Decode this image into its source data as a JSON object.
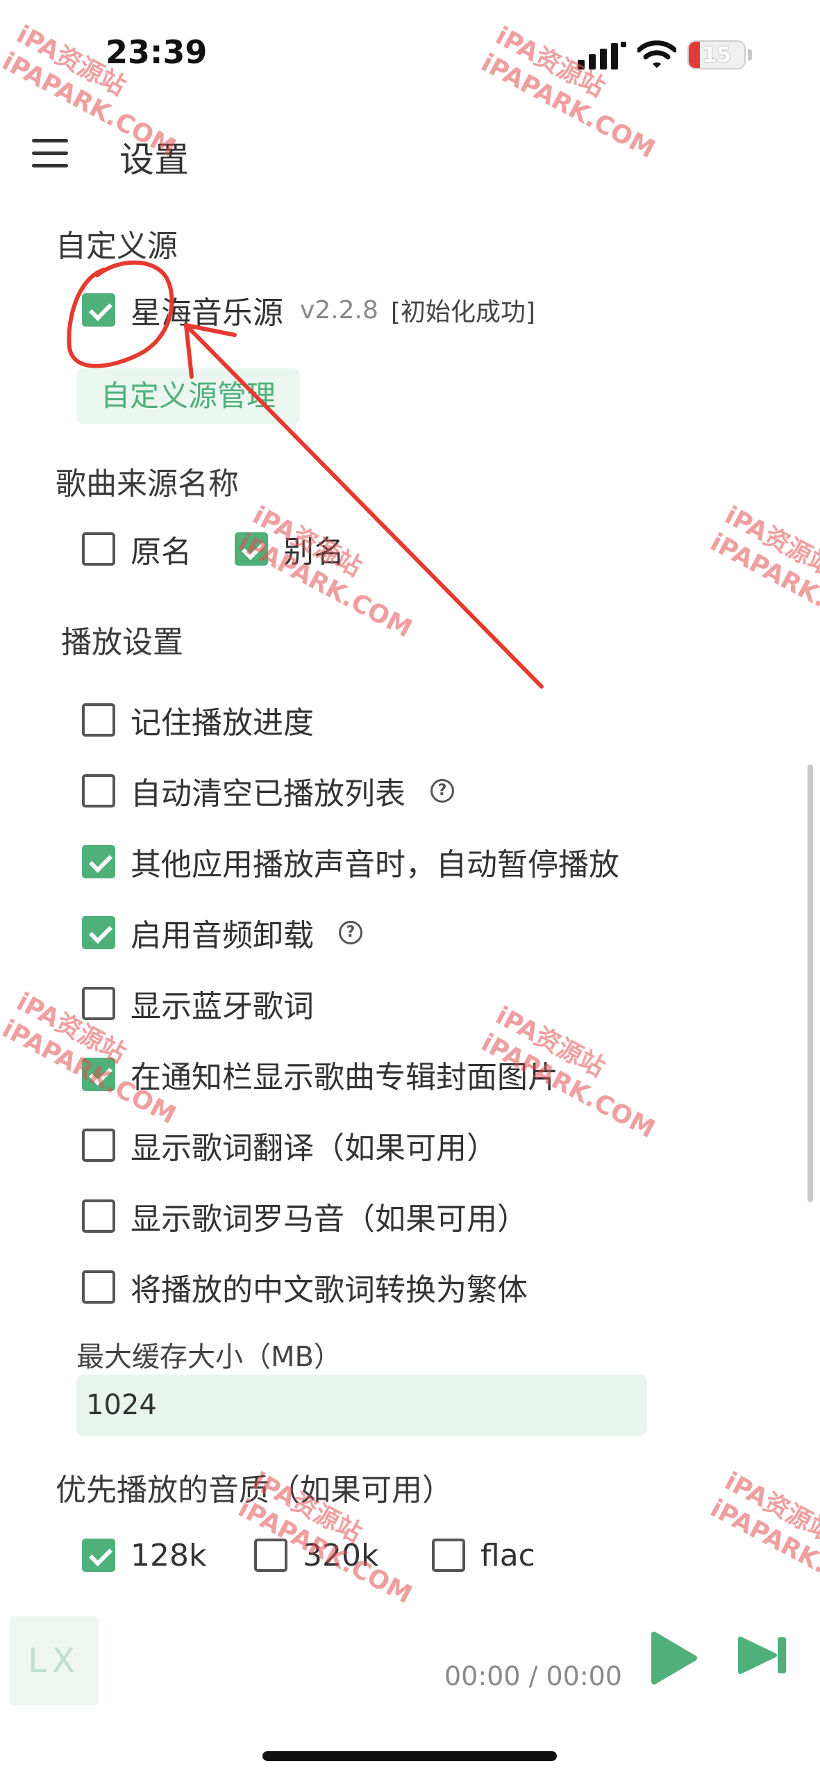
{
  "status_bar": {
    "time": "23:39",
    "battery": "15",
    "signal_icon": "signal-bars-icon",
    "wifi_icon": "wifi-icon"
  },
  "header": {
    "menu_icon": "hamburger-menu-icon",
    "title": "设置"
  },
  "custom_source": {
    "section_title": "自定义源",
    "source": {
      "name": "星海音乐源",
      "version": "v2.2.8",
      "status": "[初始化成功]",
      "checked": true
    },
    "manage_button": "自定义源管理"
  },
  "song_source_name": {
    "section_title": "歌曲来源名称",
    "options": [
      {
        "label": "原名",
        "checked": false
      },
      {
        "label": "别名",
        "checked": true
      }
    ]
  },
  "playback": {
    "section_title": "播放设置",
    "options": [
      {
        "label": "记住播放进度",
        "checked": false
      },
      {
        "label": "自动清空已播放列表",
        "checked": false,
        "help": "?"
      },
      {
        "label": "其他应用播放声音时，自动暂停播放",
        "checked": true
      },
      {
        "label": "启用音频卸载",
        "checked": true,
        "help": "?"
      },
      {
        "label": "显示蓝牙歌词",
        "checked": false
      },
      {
        "label": "在通知栏显示歌曲专辑封面图片",
        "checked": true
      },
      {
        "label": "显示歌词翻译（如果可用）",
        "checked": false
      },
      {
        "label": "显示歌词罗马音（如果可用）",
        "checked": false
      },
      {
        "label": "将播放的中文歌词转换为繁体",
        "checked": false
      }
    ],
    "cache_label": "最大缓存大小（MB）",
    "cache_value": "1024"
  },
  "quality": {
    "section_title": "优先播放的音质（如果可用）",
    "options": [
      {
        "label": "128k",
        "checked": true
      },
      {
        "label": "320k",
        "checked": false
      },
      {
        "label": "flac",
        "checked": false
      }
    ]
  },
  "player": {
    "cover_text": "LX",
    "time": "00:00 / 00:00",
    "play_icon": "play-icon",
    "next_icon": "next-track-icon"
  },
  "watermark": {
    "line1": "iPA资源站",
    "line2": "iPAPARK.COM"
  },
  "colors": {
    "accent": "#4fb07a",
    "accent_bg": "#eaf6ef",
    "annotation": "#e53a2f"
  }
}
